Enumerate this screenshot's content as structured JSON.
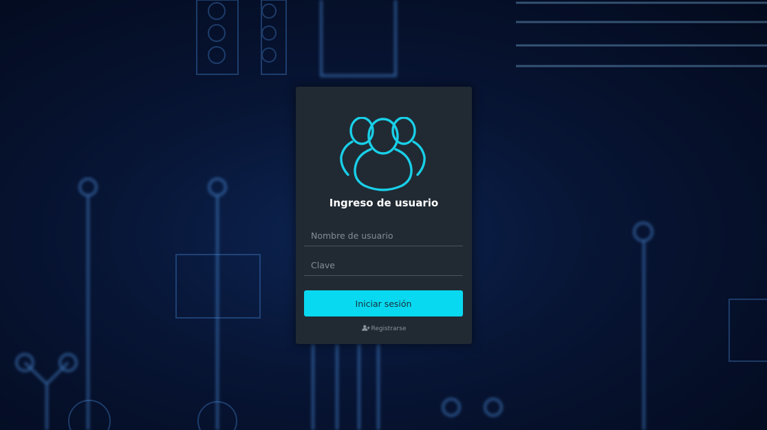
{
  "login": {
    "title": "Ingreso de usuario",
    "username_placeholder": "Nombre de usuario",
    "password_placeholder": "Clave",
    "submit_label": "Iniciar sesión",
    "register_label": "Registrarse",
    "avatar_icon": "users-group-icon",
    "register_icon": "user-plus-icon"
  },
  "theme": {
    "accent": "#08d9f0",
    "card_background": "#212a33",
    "page_background": "#071433"
  }
}
